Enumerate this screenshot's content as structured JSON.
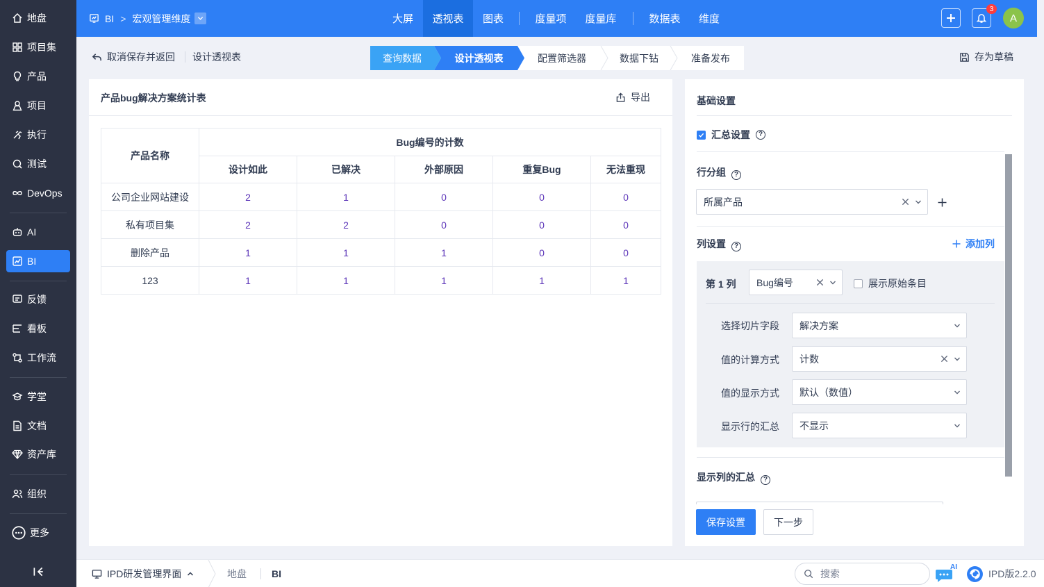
{
  "sidebar": {
    "items": [
      {
        "label": "地盘",
        "icon": "home-icon"
      },
      {
        "label": "项目集",
        "icon": "grid-icon"
      },
      {
        "label": "产品",
        "icon": "bulb-icon"
      },
      {
        "label": "项目",
        "icon": "person-icon"
      },
      {
        "label": "执行",
        "icon": "run-icon"
      },
      {
        "label": "测试",
        "icon": "test-icon"
      },
      {
        "label": "DevOps",
        "icon": "infinity-icon"
      },
      {
        "label": "AI",
        "icon": "robot-icon"
      },
      {
        "label": "BI",
        "icon": "chart-icon"
      },
      {
        "label": "反馈",
        "icon": "feedback-icon"
      },
      {
        "label": "看板",
        "icon": "kanban-icon"
      },
      {
        "label": "工作流",
        "icon": "workflow-icon"
      },
      {
        "label": "学堂",
        "icon": "school-icon"
      },
      {
        "label": "文档",
        "icon": "doc-icon"
      },
      {
        "label": "资产库",
        "icon": "diamond-icon"
      },
      {
        "label": "组织",
        "icon": "org-icon"
      },
      {
        "label": "更多",
        "icon": "more-icon"
      }
    ]
  },
  "header": {
    "module": "BI",
    "breadcrumb_sep": ">",
    "dimension": "宏观管理维度",
    "tabs": [
      "大屏",
      "透视表",
      "图表",
      "度量项",
      "度量库",
      "数据表",
      "维度"
    ],
    "active_tab": "透视表",
    "notification_count": "3",
    "avatar_letter": "A"
  },
  "subbar": {
    "back_label": "取消保存并返回",
    "page_label": "设计透视表",
    "steps": [
      "查询数据",
      "设计透视表",
      "配置筛选器",
      "数据下钻",
      "准备发布"
    ],
    "save_draft": "存为草稿"
  },
  "left": {
    "title": "产品bug解决方案统计表",
    "export": "导出",
    "table": {
      "row_header": "产品名称",
      "group_header": "Bug编号的计数",
      "columns": [
        "设计如此",
        "已解决",
        "外部原因",
        "重复Bug",
        "无法重现"
      ],
      "rows": [
        {
          "name": "公司企业网站建设",
          "values": [
            "2",
            "1",
            "0",
            "0",
            "0"
          ]
        },
        {
          "name": "私有项目集",
          "values": [
            "2",
            "2",
            "0",
            "0",
            "0"
          ]
        },
        {
          "name": "删除产品",
          "values": [
            "1",
            "1",
            "1",
            "0",
            "0"
          ]
        },
        {
          "name": "123",
          "values": [
            "1",
            "1",
            "1",
            "1",
            "1"
          ]
        }
      ]
    }
  },
  "right": {
    "basic": "基础设置",
    "summary": "汇总设置",
    "row_group": "行分组",
    "row_group_value": "所属产品",
    "col_settings": "列设置",
    "add_col": "添加列",
    "col_label": "第 1 列",
    "col_field": "Bug编号",
    "show_raw": "展示原始条目",
    "slice_label": "选择切片字段",
    "slice_value": "解决方案",
    "calc_label": "值的计算方式",
    "calc_value": "计数",
    "display_label": "值的显示方式",
    "display_value": "默认（数值）",
    "row_total_label": "显示行的汇总",
    "row_total_value": "不显示",
    "col_total": "显示列的汇总",
    "save": "保存设置",
    "next": "下一步"
  },
  "footer": {
    "app": "IPD研发管理界面",
    "crumbs": [
      "地盘",
      "BI"
    ],
    "search_placeholder": "搜索",
    "ai_label": "AI",
    "version": "IPD版2.2.0"
  },
  "colors": {
    "primary": "#2e7ff5",
    "sidebar": "#2c3243",
    "value": "#5b34b8"
  }
}
